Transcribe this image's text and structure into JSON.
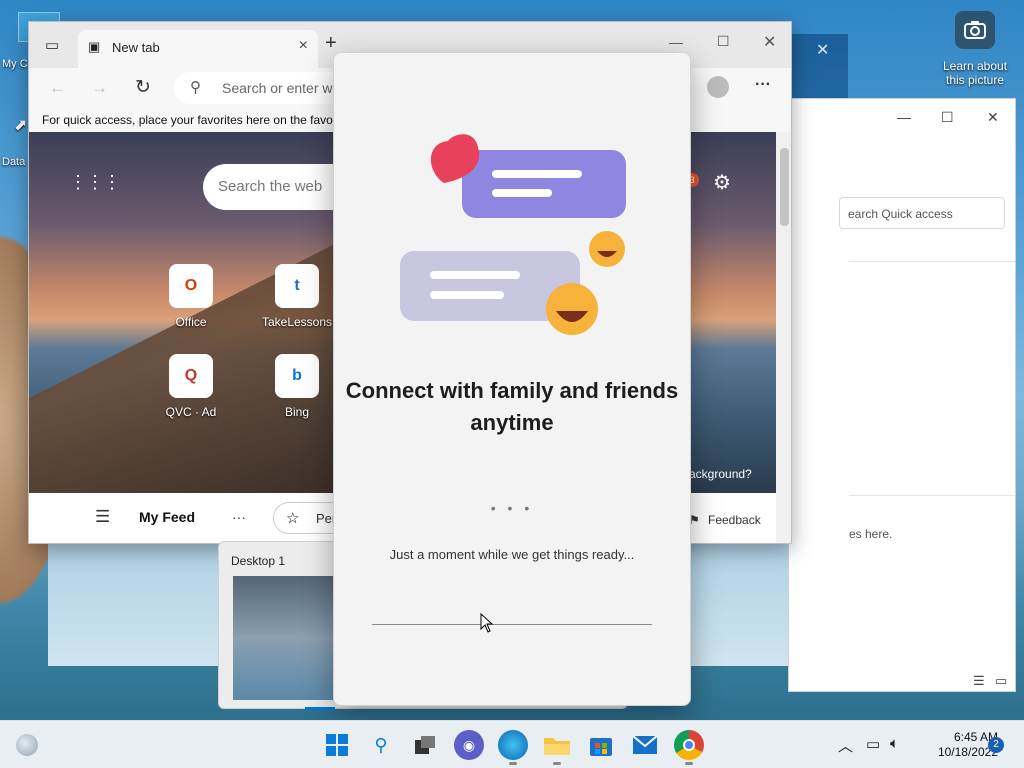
{
  "desktop": {
    "icons": [
      {
        "label": "My C"
      },
      {
        "label": "Data"
      }
    ],
    "learn_label": "Learn about this picture"
  },
  "explorer": {
    "search_placeholder": "earch Quick access",
    "hint": "es here."
  },
  "browser": {
    "tab_title": "New tab",
    "address_placeholder": "Search or enter we",
    "favorites_hint": "For quick access, place your favorites here on the favo",
    "ntp_search_placeholder": "Search the web",
    "badge_count": "3",
    "background_link": "ackground?",
    "quick_links": [
      {
        "label": "Office"
      },
      {
        "label": "TakeLessons"
      },
      {
        "label": "QVC · Ad"
      },
      {
        "label": "Bing"
      }
    ],
    "feed": {
      "title": "My Feed",
      "more": "···",
      "personalize": "Per",
      "feedback": "Feedback"
    }
  },
  "teams_dialog": {
    "heading": "Connect with family and friends anytime",
    "dots": "• • •",
    "message": "Just a moment while we get things ready..."
  },
  "task_view": {
    "desktop_label": "Desktop 1"
  },
  "taskbar": {
    "time": "6:45 AM",
    "date": "10/18/2022",
    "notification_count": "2"
  },
  "colors": {
    "accent": "#0078d4",
    "taskbar": "#e9eef3",
    "dialog_bg": "#f3f3f3",
    "bubble_purple": "#8e86e0",
    "bubble_gray": "#c9c6df"
  }
}
